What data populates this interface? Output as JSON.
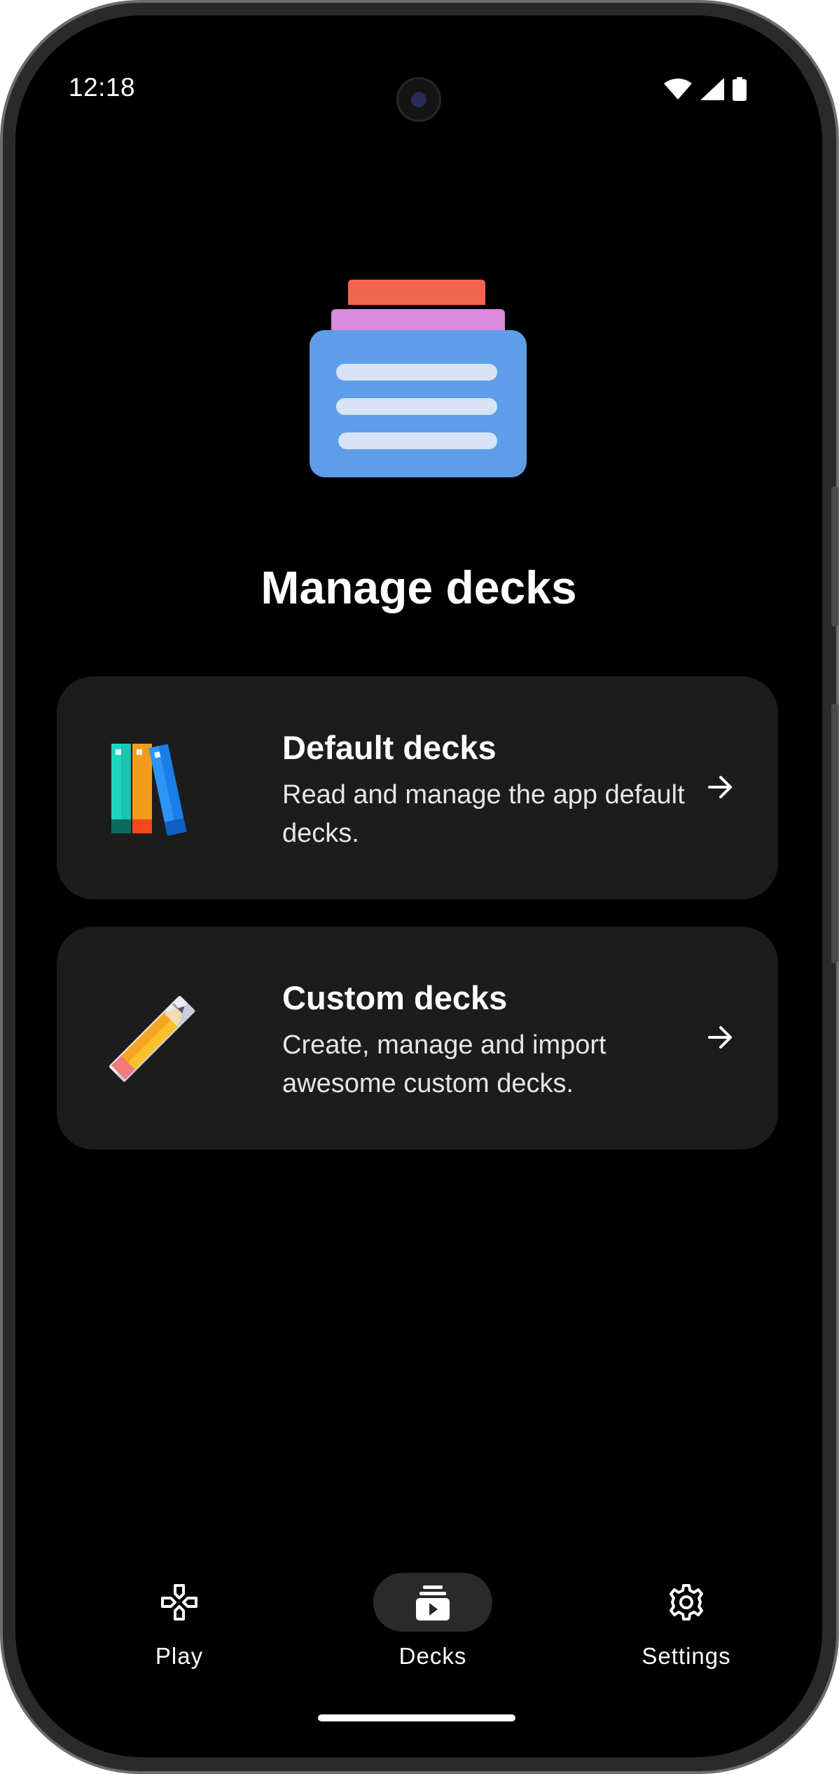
{
  "status_bar": {
    "time": "12:18",
    "icons": [
      "wifi-icon",
      "signal-icon",
      "battery-icon"
    ]
  },
  "hero": {
    "icon": "stacked-decks-icon",
    "colors": {
      "top": "#f26552",
      "middle": "#d98bdd",
      "base": "#5e9ee8",
      "lines": "#d6e4f5"
    }
  },
  "page": {
    "title": "Manage decks"
  },
  "cards": [
    {
      "title": "Default decks",
      "description": "Read and manage the app default decks.",
      "icon": "books-icon",
      "action_icon": "arrow-right-icon"
    },
    {
      "title": "Custom decks",
      "description": "Create, manage and import awesome custom decks.",
      "icon": "pencil-ruler-icon",
      "action_icon": "arrow-right-icon"
    }
  ],
  "bottom_nav": {
    "items": [
      {
        "label": "Play",
        "icon": "gamepad-icon",
        "active": false
      },
      {
        "label": "Decks",
        "icon": "decks-icon",
        "active": true
      },
      {
        "label": "Settings",
        "icon": "gear-icon",
        "active": false
      }
    ]
  },
  "colors": {
    "background": "#000000",
    "card": "#1c1c1c",
    "active_pill": "#2a2a2a",
    "text": "#ffffff"
  }
}
